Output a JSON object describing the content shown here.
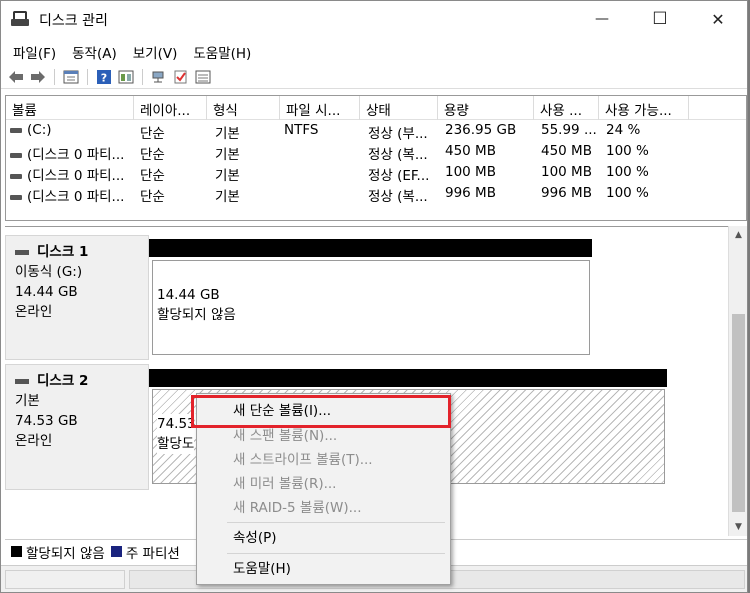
{
  "window": {
    "title": "디스크 관리",
    "min_glyph": "—",
    "max_glyph": "☐",
    "close_glyph": "✕"
  },
  "menubar": [
    "파일(F)",
    "동작(A)",
    "보기(V)",
    "도움말(H)"
  ],
  "toolbar_icons": [
    "back-icon",
    "forward-icon",
    "properties-icon",
    "help-icon",
    "detail-view-icon",
    "connect-icon",
    "check-icon",
    "list-icon"
  ],
  "volume_table": {
    "columns": [
      "볼륨",
      "레이아...",
      "형식",
      "파일 시...",
      "상태",
      "용량",
      "사용 ...",
      "사용 가능..."
    ],
    "rows": [
      [
        "(C:)",
        "단순",
        "기본",
        "NTFS",
        "정상 (부...",
        "236.95 GB",
        "55.99 ...",
        "24 %"
      ],
      [
        "(디스크 0 파티...",
        "단순",
        "기본",
        "",
        "정상 (복...",
        "450 MB",
        "450 MB",
        "100 %"
      ],
      [
        "(디스크 0 파티...",
        "단순",
        "기본",
        "",
        "정상 (EF...",
        "100 MB",
        "100 MB",
        "100 %"
      ],
      [
        "(디스크 0 파티...",
        "단순",
        "기본",
        "",
        "정상 (복...",
        "996 MB",
        "996 MB",
        "100 %"
      ]
    ]
  },
  "disks": [
    {
      "name": "디스크 1",
      "type": "이동식 (G:)",
      "size": "14.44 GB",
      "status": "온라인",
      "partition_size": "14.44 GB",
      "partition_status": "할당되지 않음"
    },
    {
      "name": "디스크 2",
      "type": "기본",
      "size": "74.53 GB",
      "status": "온라인",
      "partition_size": "74.53",
      "partition_status": "할당도"
    }
  ],
  "legend": [
    {
      "label": "할당되지 않음",
      "color": "#000000"
    },
    {
      "label": "주 파티션",
      "color": "#1a237e"
    }
  ],
  "context_menu": {
    "items": [
      {
        "label": "새 단순 볼륨(I)...",
        "enabled": true
      },
      {
        "label": "새 스팬 볼륨(N)...",
        "enabled": false
      },
      {
        "label": "새 스트라이프 볼륨(T)...",
        "enabled": false
      },
      {
        "label": "새 미러 볼륨(R)...",
        "enabled": false
      },
      {
        "label": "새 RAID-5 볼륨(W)...",
        "enabled": false
      },
      {
        "label": "속성(P)",
        "enabled": true
      },
      {
        "label": "도움말(H)",
        "enabled": true
      }
    ]
  },
  "colors": {
    "highlight_border": "#e3232b",
    "unallocated": "#000000",
    "primary_partition": "#1a237e"
  }
}
